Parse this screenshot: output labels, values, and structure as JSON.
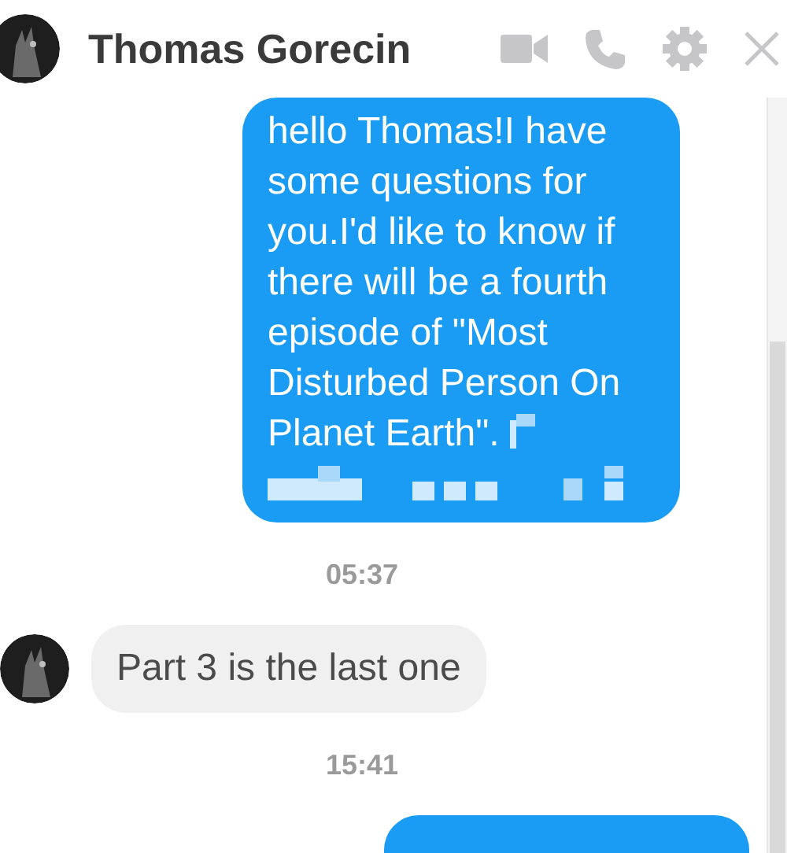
{
  "header": {
    "contact_name": "Thomas Gorecin"
  },
  "messages": [
    {
      "kind": "sent",
      "text": "hello Thomas!I have some questions for you.I'd like to know if there will be a fourth episode of \"Most Disturbed Person On Planet Earth\".",
      "censored": true
    },
    {
      "kind": "time",
      "text": "05:37"
    },
    {
      "kind": "received",
      "text": "Part 3 is the last one"
    },
    {
      "kind": "time",
      "text": "15:41"
    },
    {
      "kind": "sent_cut"
    }
  ]
}
